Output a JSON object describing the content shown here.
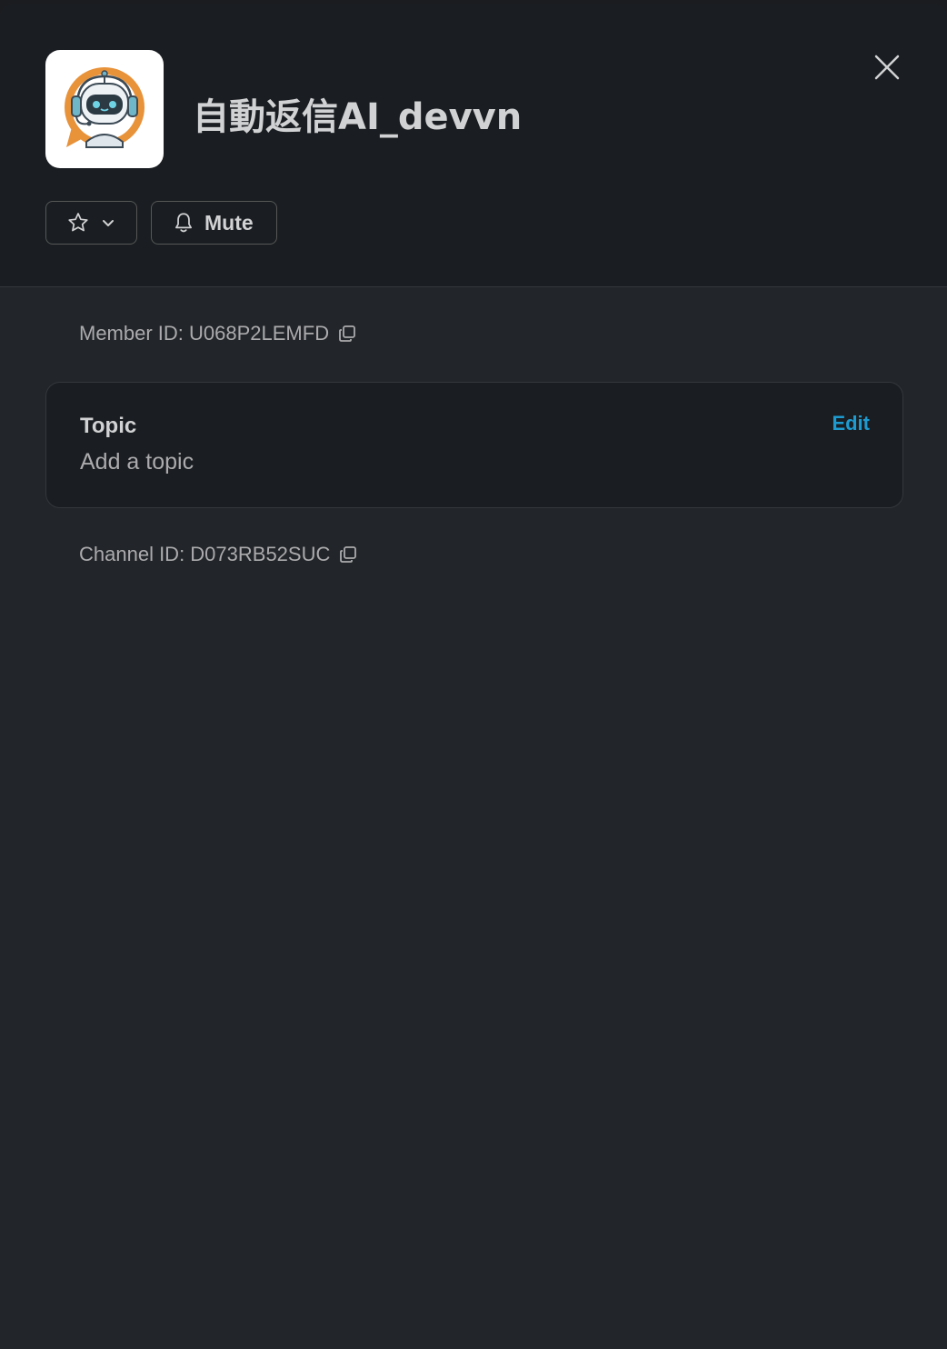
{
  "header": {
    "title": "自動返信AI_devvn",
    "avatar_icon": "robot-headset-avatar",
    "close_icon": "close-icon",
    "star_icon": "star-icon",
    "chevron_icon": "chevron-down-icon",
    "mute_icon": "bell-icon",
    "mute_label": "Mute"
  },
  "details": {
    "member_id": "Member ID: U068P2LEMFD",
    "topic": {
      "title": "Topic",
      "value": "Add a topic",
      "edit_label": "Edit"
    },
    "channel_id": "Channel ID: D073RB52SUC"
  },
  "colors": {
    "accent_link": "#1d9bd1",
    "modal_bg": "#222529",
    "header_bg": "#1a1d21",
    "text_primary": "#d1d2d3",
    "text_secondary": "#ababad"
  }
}
